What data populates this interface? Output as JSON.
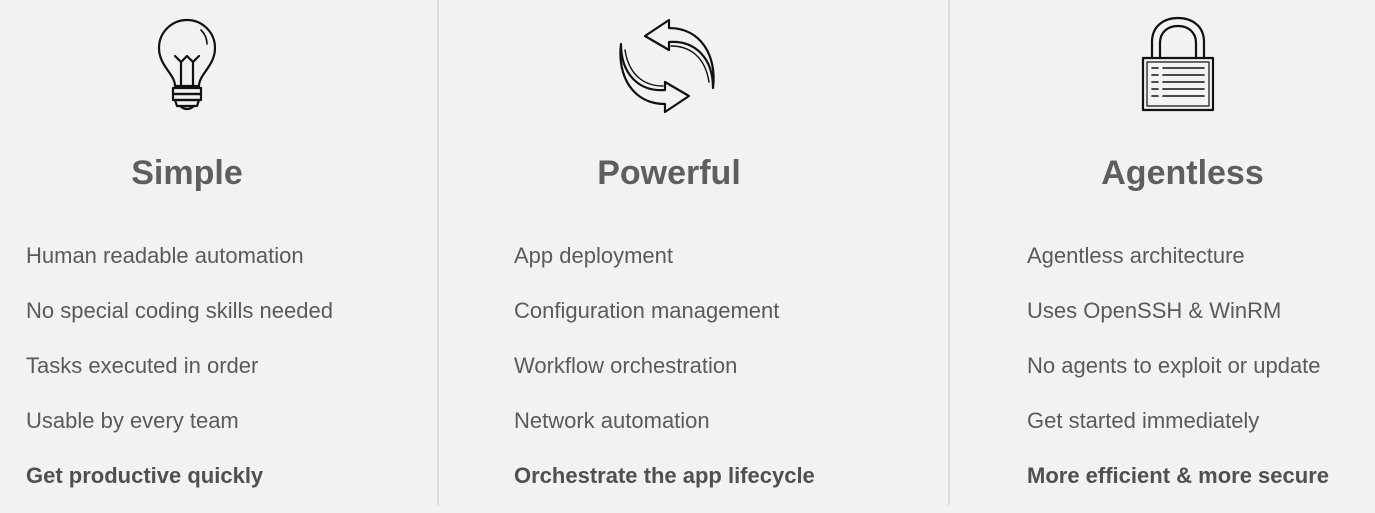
{
  "columns": [
    {
      "icon": "lightbulb-icon",
      "title": "Simple",
      "items": [
        "Human readable automation",
        "No special coding skills needed",
        "Tasks executed in order",
        "Usable by every team"
      ],
      "highlight": "Get productive quickly"
    },
    {
      "icon": "sync-arrows-icon",
      "title": "Powerful",
      "items": [
        "App deployment",
        "Configuration management",
        "Workflow orchestration",
        "Network automation"
      ],
      "highlight": "Orchestrate the app lifecycle"
    },
    {
      "icon": "padlock-icon",
      "title": "Agentless",
      "items": [
        "Agentless architecture",
        "Uses OpenSSH & WinRM",
        "No agents to exploit or update",
        "Get started immediately"
      ],
      "highlight": "More efficient & more secure"
    }
  ],
  "colors": {
    "background": "#f2f2f2",
    "divider": "#dedede",
    "text": "#5a5a5a",
    "icon_stroke": "#111111"
  }
}
